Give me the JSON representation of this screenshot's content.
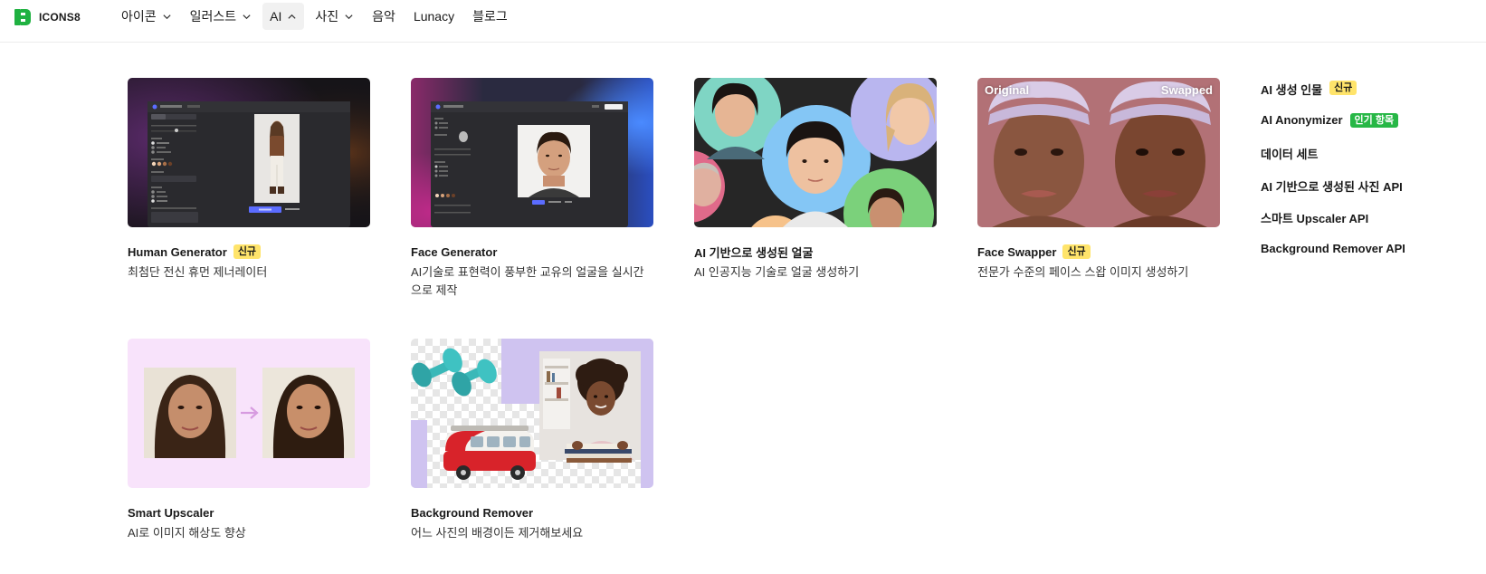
{
  "header": {
    "logo_text": "ICONS8",
    "nav": [
      {
        "label": "아이콘",
        "chevron": "down"
      },
      {
        "label": "일러스트",
        "chevron": "down"
      },
      {
        "label": "AI",
        "chevron": "up",
        "active": true
      },
      {
        "label": "사진",
        "chevron": "down"
      },
      {
        "label": "음악"
      },
      {
        "label": "Lunacy"
      },
      {
        "label": "블로그"
      }
    ]
  },
  "cards": [
    {
      "title": "Human Generator",
      "badge": "신규",
      "desc": "최첨단 전신 휴먼 제너레이터"
    },
    {
      "title": "Face Generator",
      "desc": "AI기술로 표현력이 풍부한 교유의 얼굴을 실시간으로 제작"
    },
    {
      "title": "AI 기반으로 생성된 얼굴",
      "desc": "AI 인공지능 기술로 얼굴 생성하기"
    },
    {
      "title": "Face Swapper",
      "badge": "신규",
      "desc": "전문가 수준의 페이스 스왑 이미지 생성하기",
      "thumb_labels": [
        "Original",
        "Swapped"
      ]
    },
    {
      "title": "Smart Upscaler",
      "desc": "AI로 이미지 해상도 향상"
    },
    {
      "title": "Background Remover",
      "desc": "어느 사진의 배경이든 제거해보세요"
    }
  ],
  "side_links": [
    {
      "label": "AI 생성 인물",
      "badge": "신규",
      "badge_type": "new"
    },
    {
      "label": "AI Anonymizer",
      "badge": "인기 항목",
      "badge_type": "popular"
    },
    {
      "label": "데이터 세트"
    },
    {
      "label": "AI 기반으로 생성된 사진 API"
    },
    {
      "label": "스마트 Upscaler API"
    },
    {
      "label": "Background Remover API"
    }
  ],
  "colors": {
    "brand": "#1fb141",
    "badge_new": "#ffe46b",
    "badge_popular": "#27b746"
  }
}
